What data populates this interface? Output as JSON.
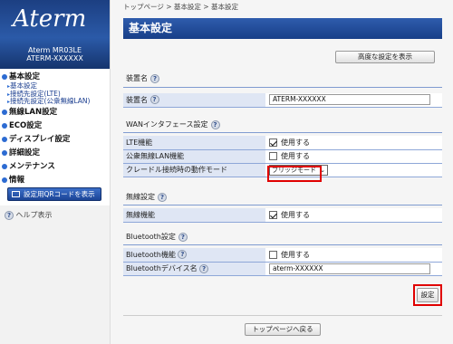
{
  "sidebar": {
    "logo": "Aterm",
    "model_line1": "Aterm MR03LE",
    "model_line2": "ATERM-XXXXXX",
    "menu": [
      {
        "label": "基本設定",
        "subs": [
          "基本設定",
          "接続先設定(LTE)",
          "接続先設定(公衆無線LAN)"
        ]
      },
      {
        "label": "無線LAN設定",
        "subs": []
      },
      {
        "label": "ECO設定",
        "subs": []
      },
      {
        "label": "ディスプレイ設定",
        "subs": []
      },
      {
        "label": "詳細設定",
        "subs": []
      },
      {
        "label": "メンテナンス",
        "subs": []
      },
      {
        "label": "情報",
        "subs": []
      }
    ],
    "qr_button": "設定用QRコードを表示",
    "help_label": "ヘルプ表示"
  },
  "breadcrumb": "トップページ > 基本設定 > 基本設定",
  "page_title": "基本設定",
  "adv_button": "高度な設定を表示",
  "sections": {
    "device": {
      "title": "装置名",
      "rows": {
        "device_name_label": "装置名",
        "device_name_value": "ATERM-XXXXXX"
      }
    },
    "wan": {
      "title": "WANインタフェース設定",
      "lte_label": "LTE機能",
      "lte_value": "使用する",
      "wlan_label": "公衆無線LAN機能",
      "wlan_value": "使用する",
      "cradle_label": "クレードル接続時の動作モード",
      "cradle_value": "ブリッジモード"
    },
    "wireless": {
      "title": "無線設定",
      "wireless_label": "無線機能",
      "wireless_value": "使用する"
    },
    "bluetooth": {
      "title": "Bluetooth設定",
      "bt_label": "Bluetooth機能",
      "bt_value": "使用する",
      "bt_name_label": "Bluetoothデバイス名",
      "bt_name_value": "aterm-XXXXXX"
    }
  },
  "help_icon": "?",
  "set_button": "設定",
  "top_button": "トップページへ戻る",
  "colors": {
    "accent": "#1b4496",
    "highlight": "#e00000"
  }
}
